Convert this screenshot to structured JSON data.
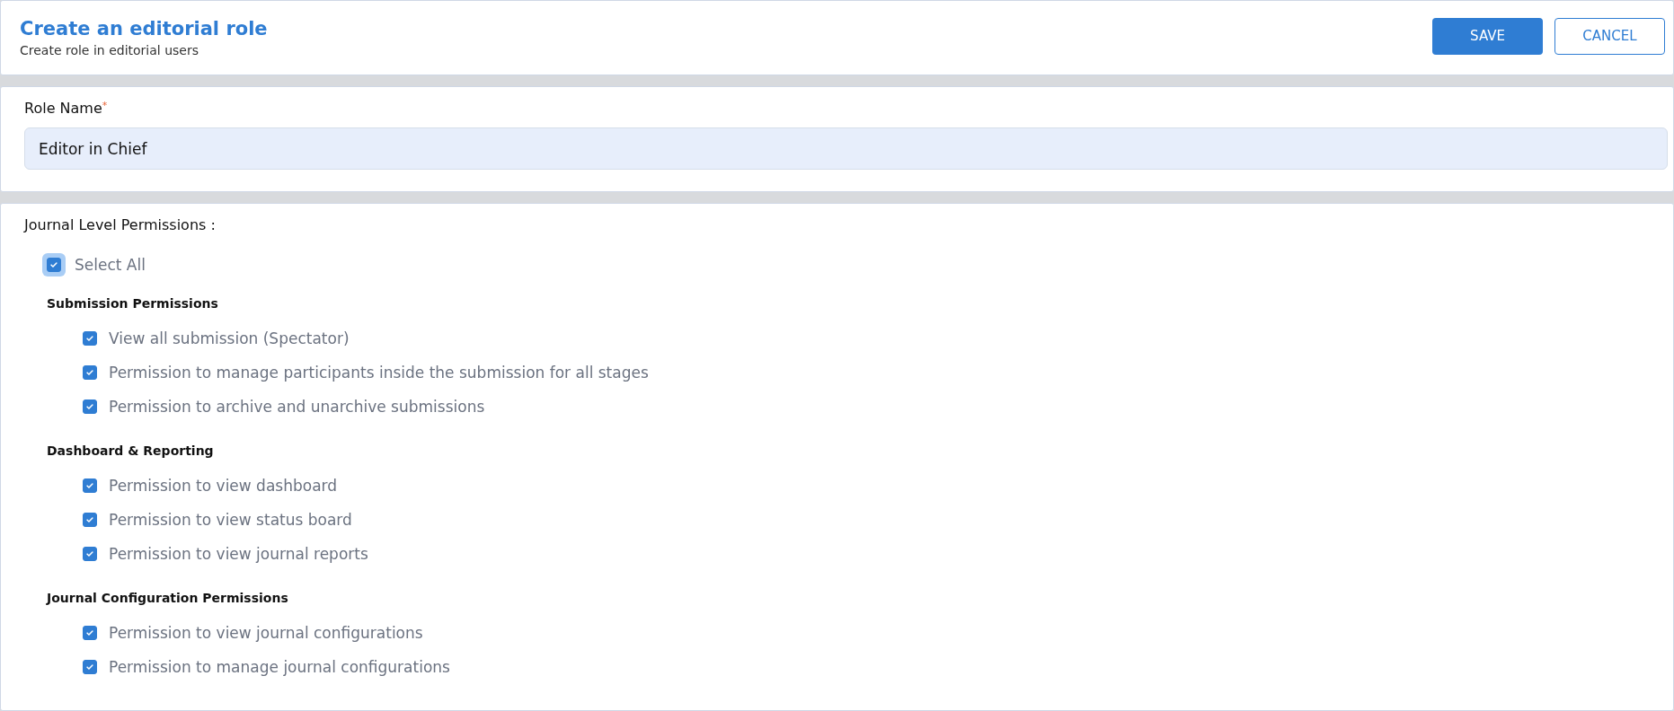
{
  "header": {
    "title": "Create an editorial role",
    "subtitle": "Create role in editorial users",
    "buttons": [
      {
        "label": "SAVE",
        "kind": "primary"
      },
      {
        "label": "CANCEL",
        "kind": "secondary"
      }
    ]
  },
  "role_name": {
    "label": "Role Name",
    "required_mark": "*",
    "value": "Editor in Chief"
  },
  "permissions": {
    "heading": "Journal Level Permissions :",
    "select_all": {
      "label": "Select All",
      "checked": true
    },
    "groups": [
      {
        "title": "Submission Permissions",
        "items": [
          {
            "label": "View all submission (Spectator)",
            "checked": true
          },
          {
            "label": "Permission to manage participants inside the submission for all stages",
            "checked": true
          },
          {
            "label": "Permission to archive and unarchive submissions",
            "checked": true
          }
        ]
      },
      {
        "title": "Dashboard & Reporting",
        "items": [
          {
            "label": "Permission to view dashboard",
            "checked": true
          },
          {
            "label": "Permission to view status board",
            "checked": true
          },
          {
            "label": "Permission to view journal reports",
            "checked": true
          }
        ]
      },
      {
        "title": "Journal Configuration Permissions",
        "items": [
          {
            "label": "Permission to view journal configurations",
            "checked": true
          },
          {
            "label": "Permission to manage journal configurations",
            "checked": true
          }
        ]
      }
    ]
  }
}
